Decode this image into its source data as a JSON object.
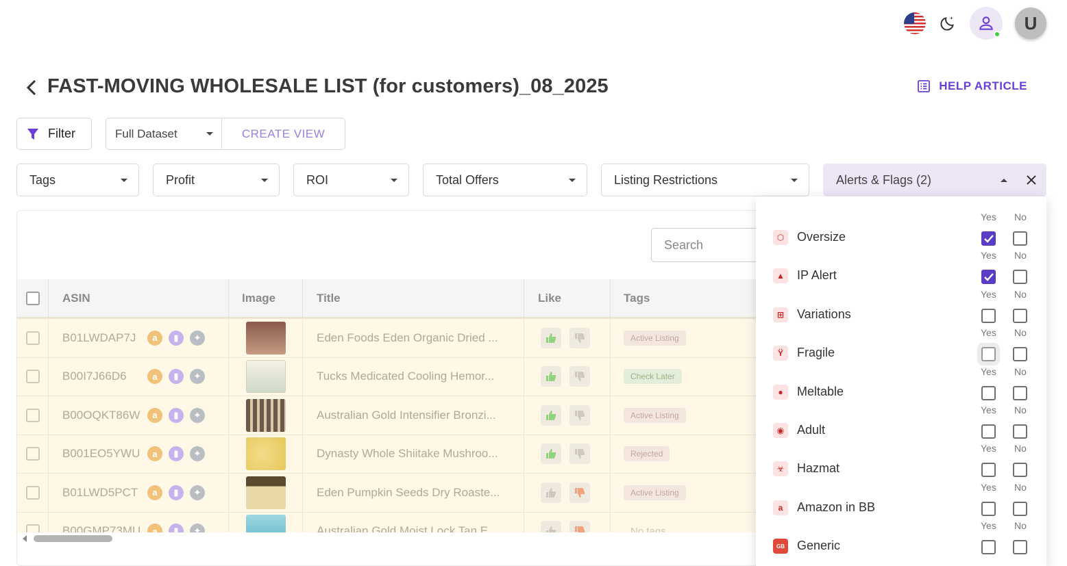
{
  "topbar": {
    "avatar_letter": "U",
    "colors": {
      "accent": "#6a3fd8",
      "online": "#3fd13f"
    }
  },
  "page": {
    "title": "FAST-MOVING WHOLESALE LIST (for customers)_08_2025",
    "help_label": "HELP ARTICLE"
  },
  "toolbar": {
    "filter_label": "Filter",
    "view_selected": "Full Dataset",
    "create_view_label": "CREATE VIEW"
  },
  "filters": {
    "tags": "Tags",
    "profit": "Profit",
    "roi": "ROI",
    "total_offers": "Total Offers",
    "listing_restrictions": "Listing Restrictions",
    "alerts_flags": "Alerts & Flags (2)"
  },
  "table": {
    "search_placeholder": "Search",
    "columns": [
      "ASIN",
      "Image",
      "Title",
      "Like",
      "Tags"
    ],
    "rows": [
      {
        "asin": "B01LWDAP7J",
        "title": "Eden Foods Eden Organic Dried ...",
        "tag": "Active Listing",
        "like": "up"
      },
      {
        "asin": "B00I7J66D6",
        "title": "Tucks Medicated Cooling Hemor...",
        "tag": "Check Later",
        "like": "up"
      },
      {
        "asin": "B00OQKT86W",
        "title": "Australian Gold Intensifier Bronzi...",
        "tag": "Active Listing",
        "like": "up"
      },
      {
        "asin": "B001EO5YWU",
        "title": "Dynasty Whole Shiitake Mushroo...",
        "tag": "Rejected",
        "like": "up"
      },
      {
        "asin": "B01LWD5PCT",
        "title": "Eden Pumpkin Seeds Dry Roaste...",
        "tag": "Active Listing",
        "like": "down"
      },
      {
        "asin": "B00GMP73MU",
        "title": "Australian Gold Moist Lock Tan E...",
        "tag": "No tags",
        "like": "down"
      }
    ]
  },
  "alerts": {
    "yes_label": "Yes",
    "no_label": "No",
    "items": [
      {
        "name": "Oversize",
        "yes": true,
        "no": false,
        "icon": "box-icon"
      },
      {
        "name": "IP Alert",
        "yes": true,
        "no": false,
        "icon": "warning-icon"
      },
      {
        "name": "Variations",
        "yes": false,
        "no": false,
        "icon": "hierarchy-icon"
      },
      {
        "name": "Fragile",
        "yes": false,
        "no": false,
        "icon": "glass-icon"
      },
      {
        "name": "Meltable",
        "yes": false,
        "no": false,
        "icon": "drop-icon"
      },
      {
        "name": "Adult",
        "yes": false,
        "no": false,
        "icon": "adult-icon"
      },
      {
        "name": "Hazmat",
        "yes": false,
        "no": false,
        "icon": "biohazard-icon"
      },
      {
        "name": "Amazon in BB",
        "yes": false,
        "no": false,
        "icon": "amazon-icon"
      },
      {
        "name": "Generic",
        "yes": false,
        "no": false,
        "icon": "generic-icon"
      }
    ]
  }
}
